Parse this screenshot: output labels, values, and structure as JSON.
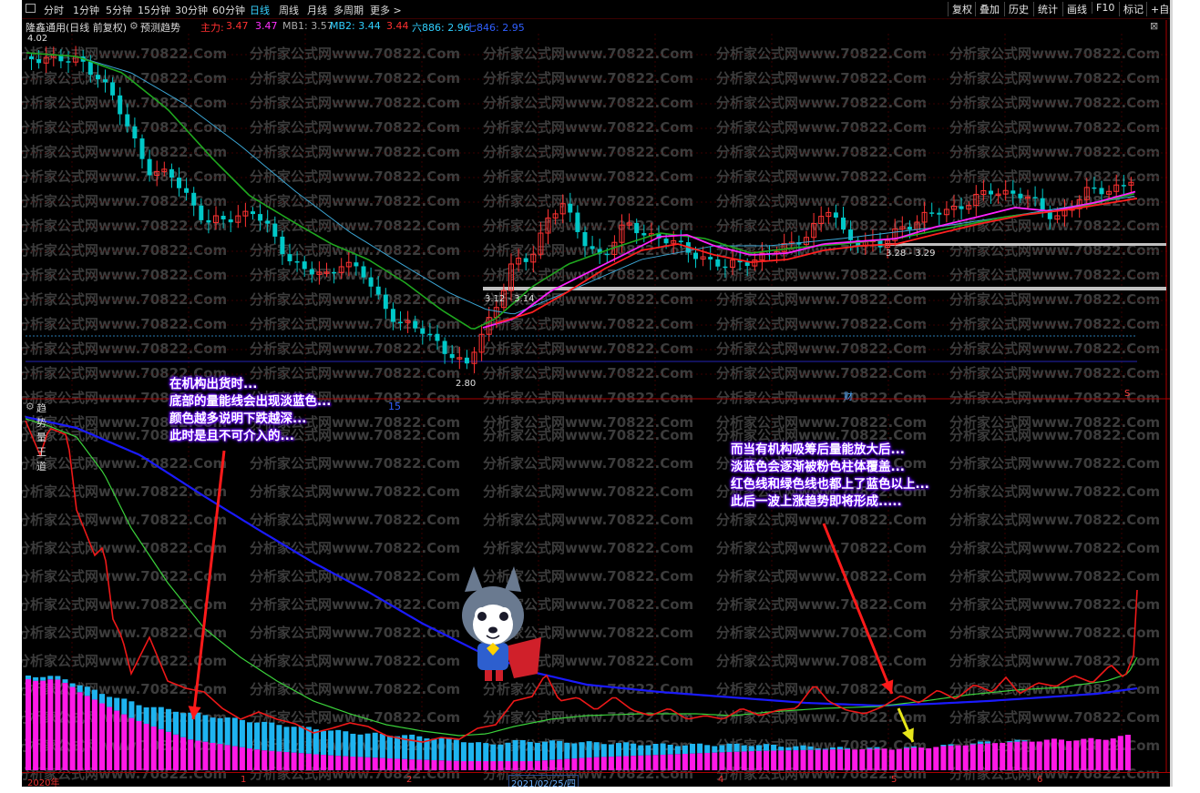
{
  "toolbar": {
    "periods": [
      "分时",
      "1分钟",
      "5分钟",
      "15分钟",
      "30分钟",
      "60分钟",
      "日线",
      "周线",
      "月线",
      "多周期",
      "更多 >"
    ],
    "active_period": "日线",
    "right_buttons": [
      "复权",
      "叠加",
      "历史",
      "统计",
      "画线",
      "F10",
      "标记",
      "+自选"
    ]
  },
  "infobar": {
    "stock": "隆鑫通用(日线 前复权)",
    "indicator": "预测趋势",
    "main_label": "主力:",
    "main_v1": "3.47",
    "main_v2": "3.47",
    "mb1": "MB1: 3.57",
    "mb2": "MB2: 3.44",
    "v3": "3.44",
    "six": "六886: 2.96",
    "seven": "七846: 2.95"
  },
  "price_labels": {
    "high": "4.02",
    "low": "2.80",
    "zone1": "3.12 - 3.14",
    "zone2": "3.28 - 3.29",
    "cai": "财",
    "s": "S"
  },
  "sub_panel": {
    "title": "趋势量王道",
    "extra": "15"
  },
  "annotations": {
    "left": [
      "在机构出货时...",
      "底部的量能线会出现淡蓝色...",
      "颜色越多说明下跌越深...",
      "此时是且不可介入的..."
    ],
    "right": [
      "而当有机构吸筹后量能放大后...",
      "淡蓝色会逐渐被粉色柱体覆盖...",
      "红色线和绿色线也都上了蓝色以上...",
      "此后一波上涨趋势即将形成....."
    ]
  },
  "xaxis": {
    "labels": [
      "2020年",
      "1",
      "2",
      "2021/02/25/四",
      "4",
      "5",
      "6"
    ]
  },
  "watermark": "分析家公式网www.70822.Com",
  "colors": {
    "up": "#ff3232",
    "down": "#00c8c8",
    "ma_green": "#1fa81f",
    "ma_lightblue": "#3ca7d6",
    "ma_magenta": "#ff22ff",
    "ma_red": "#ff2020",
    "bar_pink": "#ff19e6",
    "bar_cyan": "#1eb4f0",
    "line_blue": "#1a1aff"
  }
}
